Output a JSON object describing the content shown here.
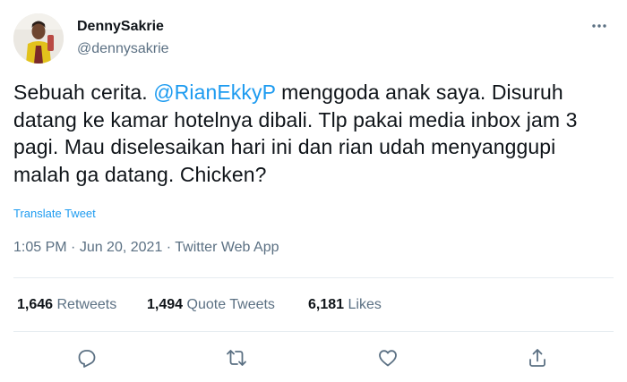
{
  "author": {
    "display_name": "DennySakrie",
    "handle": "@dennysakrie",
    "avatar_icon": "profile-photo"
  },
  "tweet": {
    "text_segments": [
      "Sebuah cerita. ",
      "@RianEkkyP",
      " menggoda anak saya. Disuruh datang ke kamar hotelnya dibali. Tlp pakai media inbox jam 3 pagi. Mau diselesaikan hari ini dan rian udah menyanggupi malah ga datang. Chicken?"
    ],
    "translate_label": "Translate Tweet",
    "time": "1:05 PM",
    "separator": " · ",
    "date": "Jun 20, 2021",
    "source": "Twitter Web App"
  },
  "stats": {
    "retweets_count": "1,646",
    "retweets_label": "Retweets",
    "quotes_count": "1,494",
    "quotes_label": "Quote Tweets",
    "likes_count": "6,181",
    "likes_label": "Likes"
  },
  "actions": {
    "reply_icon": "reply-icon",
    "retweet_icon": "retweet-icon",
    "like_icon": "like-icon",
    "share_icon": "share-icon",
    "more_icon": "more-icon"
  },
  "colors": {
    "accent": "#1d9bf0",
    "secondary_text": "#5b7083",
    "divider": "#e6ecf0"
  }
}
